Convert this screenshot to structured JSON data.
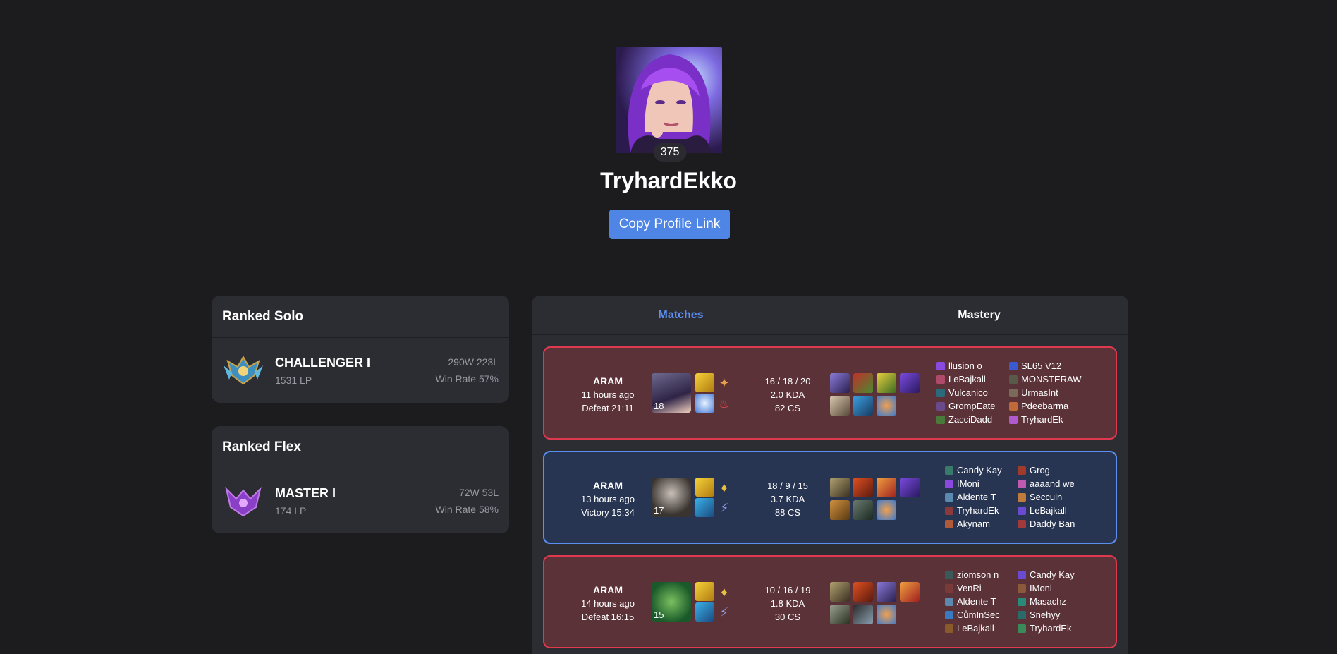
{
  "profile": {
    "level": "375",
    "name": "TryhardEkko",
    "copy_label": "Copy Profile Link"
  },
  "ranked": [
    {
      "title": "Ranked Solo",
      "tier": "CHALLENGER I",
      "lp": "1531 LP",
      "record": "290W 223L",
      "winrate": "Win Rate 57%",
      "emblem_color": "#5fb8e0"
    },
    {
      "title": "Ranked Flex",
      "tier": "MASTER I",
      "lp": "174 LP",
      "record": "72W 53L",
      "winrate": "Win Rate 58%",
      "emblem_color": "#9b4fd6"
    }
  ],
  "tabs": [
    "Matches",
    "Mastery"
  ],
  "matches": [
    {
      "mode": "ARAM",
      "time": "11 hours ago",
      "result": "Defeat 21:11",
      "outcome": "defeat",
      "champ_level": "18",
      "kda": "16 / 18 / 20",
      "kda_ratio": "2.0 KDA",
      "cs": "82 CS",
      "players_left": [
        "llusion o",
        "LeBajkall",
        "Vulcanico",
        "GrompEate",
        "ZacciDadd"
      ],
      "players_right": [
        "SL65 V12",
        "MONSTERAW",
        "UrmasInt",
        "Pdeebarma",
        "TryhardEk"
      ]
    },
    {
      "mode": "ARAM",
      "time": "13 hours ago",
      "result": "Victory 15:34",
      "outcome": "victory",
      "champ_level": "17",
      "kda": "18 / 9 / 15",
      "kda_ratio": "3.7 KDA",
      "cs": "88 CS",
      "players_left": [
        "Candy Kay",
        "IMoni",
        "Aldente T",
        "TryhardEk",
        "Akynam"
      ],
      "players_right": [
        "Grog",
        "aaaand we",
        "Seccuin",
        "LeBajkall",
        "Daddy Ban"
      ]
    },
    {
      "mode": "ARAM",
      "time": "14 hours ago",
      "result": "Defeat 16:15",
      "outcome": "defeat",
      "champ_level": "15",
      "kda": "10 / 16 / 19",
      "kda_ratio": "1.8 KDA",
      "cs": "30 CS",
      "players_left": [
        "ziomson n",
        "VenRi",
        "Aldente T",
        "CůmInSec",
        "LeBajkall"
      ],
      "players_right": [
        "Candy Kay",
        "IMoni",
        "Masachz",
        "Snehyy",
        "TryhardEk"
      ]
    }
  ]
}
